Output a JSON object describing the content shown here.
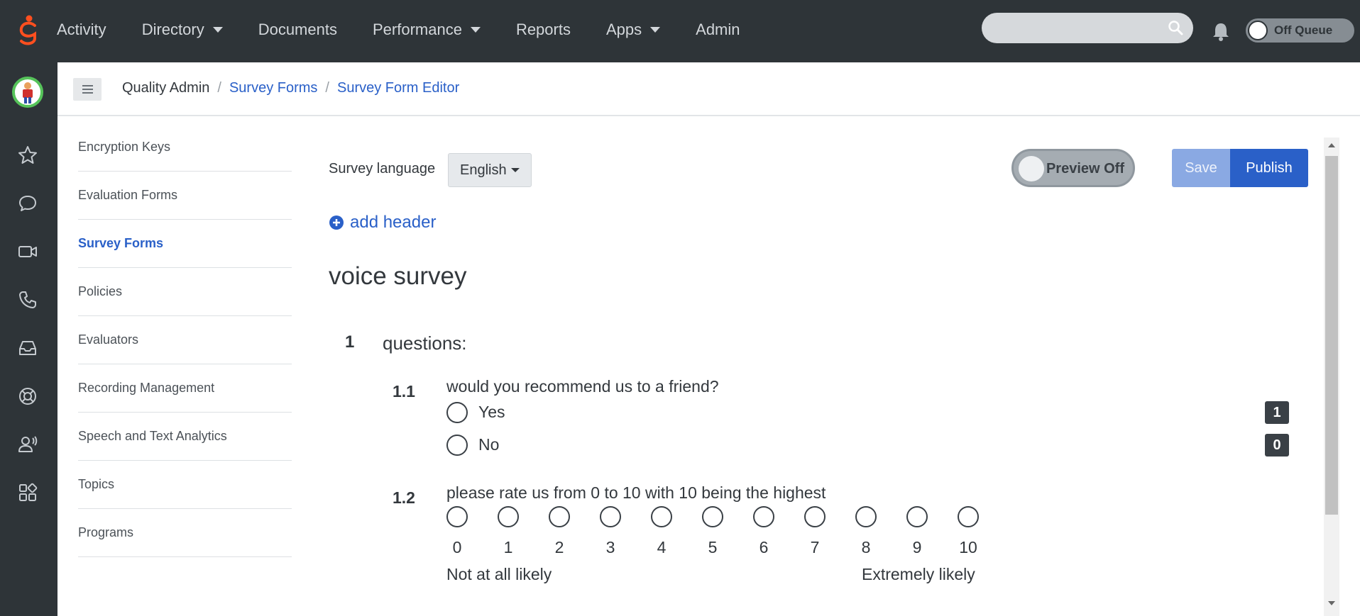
{
  "topbar": {
    "nav": [
      {
        "label": "Activity",
        "dropdown": false
      },
      {
        "label": "Directory",
        "dropdown": true
      },
      {
        "label": "Documents",
        "dropdown": false
      },
      {
        "label": "Performance",
        "dropdown": true
      },
      {
        "label": "Reports",
        "dropdown": false
      },
      {
        "label": "Apps",
        "dropdown": true
      },
      {
        "label": "Admin",
        "dropdown": false
      }
    ],
    "search": {
      "value": "",
      "placeholder": ""
    },
    "queue_label": "Off Queue"
  },
  "breadcrumb": {
    "root": "Quality Admin",
    "sep": "/",
    "level1": "Survey Forms",
    "level2": "Survey Form Editor"
  },
  "subnav": [
    {
      "label": "Encryption Keys",
      "active": false
    },
    {
      "label": "Evaluation Forms",
      "active": false
    },
    {
      "label": "Survey Forms",
      "active": true
    },
    {
      "label": "Policies",
      "active": false
    },
    {
      "label": "Evaluators",
      "active": false
    },
    {
      "label": "Recording Management",
      "active": false
    },
    {
      "label": "Speech and Text Analytics",
      "active": false
    },
    {
      "label": "Topics",
      "active": false
    },
    {
      "label": "Programs",
      "active": false
    }
  ],
  "editor": {
    "language_label": "Survey language",
    "language_value": "English",
    "preview_label": "Preview Off",
    "save_label": "Save",
    "publish_label": "Publish",
    "add_header_label": "add header",
    "form_title": "voice survey",
    "section": {
      "number": "1",
      "title": "questions:",
      "questions": [
        {
          "number": "1.1",
          "text": "would you recommend us to a friend?",
          "answers": [
            {
              "label": "Yes",
              "score": "1"
            },
            {
              "label": "No",
              "score": "0"
            }
          ]
        },
        {
          "number": "1.2",
          "text": "please rate us from 0 to 10 with 10 being the highest",
          "scale": [
            "0",
            "1",
            "2",
            "3",
            "4",
            "5",
            "6",
            "7",
            "8",
            "9",
            "10"
          ],
          "low_anchor": "Not at all likely",
          "high_anchor": "Extremely likely"
        }
      ]
    }
  },
  "colors": {
    "topbar_bg": "#2e3438",
    "accent": "#2a60c8",
    "logo": "#ff4f1f"
  },
  "icons": [
    "genesys-logo-icon",
    "search-icon",
    "bell-icon",
    "star-icon",
    "chat-icon",
    "video-icon",
    "phone-icon",
    "inbox-icon",
    "support-icon",
    "agent-icon",
    "apps-icon",
    "plus-circle-icon"
  ]
}
